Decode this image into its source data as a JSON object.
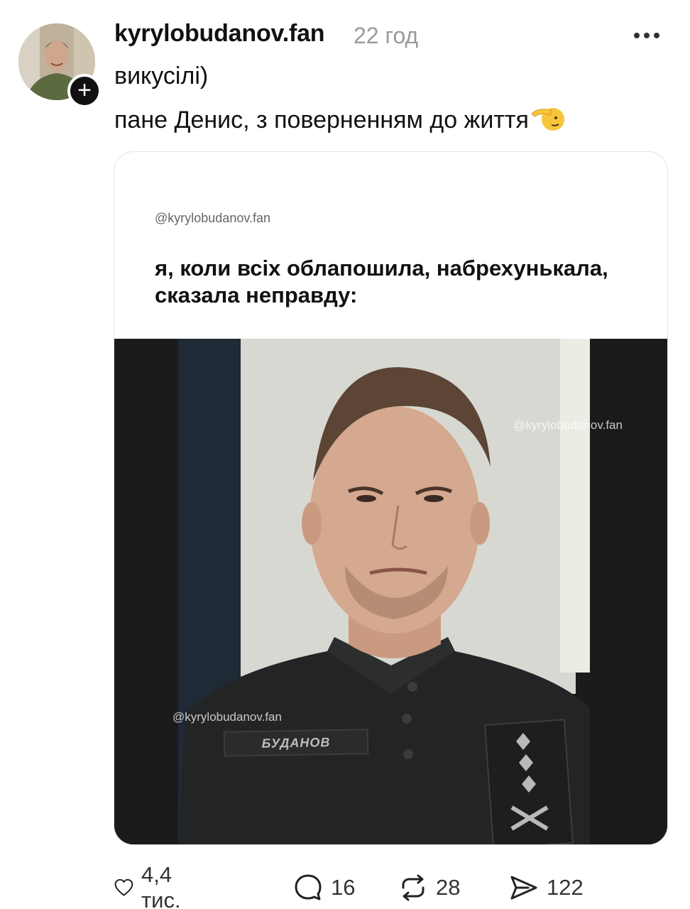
{
  "post": {
    "username": "kyrylobudanov.fan",
    "time": "22 год",
    "text_line1": "викусілі)",
    "text_line2": "пане Денис, з поверненням до життя"
  },
  "media": {
    "watermark_top": "@kyrylobudanov.fan",
    "caption": "я, коли всіх облапошила, набрехунькала,\nсказала неправду:",
    "watermark_mid": "@kyrylobudanov.fan",
    "watermark_low": "@kyrylobudanov.fan",
    "name_patch": "БУДАНОВ"
  },
  "actions": {
    "likes": "4,4 тис.",
    "replies": "16",
    "reposts": "28",
    "shares": "122"
  },
  "icons": {
    "like": "heart-icon",
    "reply": "comment-bubble-icon",
    "repost": "repost-arrows-icon",
    "share": "send-icon",
    "more": "more-dots-icon",
    "follow": "plus-icon",
    "emoji": "saluting-face-emoji"
  }
}
